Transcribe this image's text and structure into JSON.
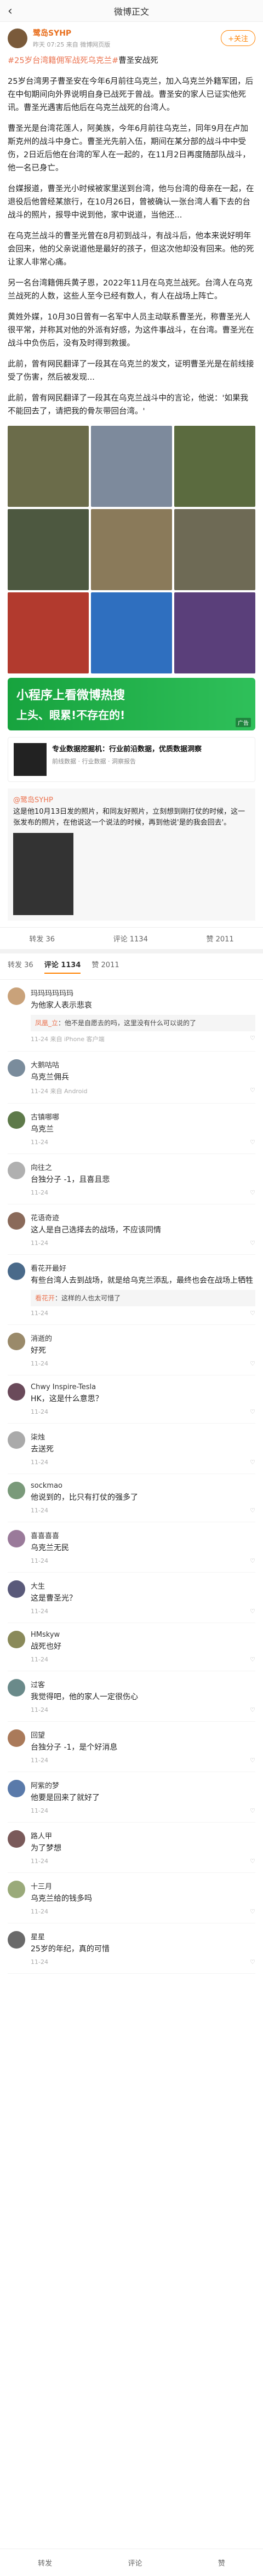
{
  "topbar": {
    "title": "微博正文",
    "back": "‹"
  },
  "author": {
    "name": "鹭岛SYHP",
    "time": "昨天 07:25 来自 微博网页版",
    "follow": "+关注"
  },
  "post": {
    "hashtag": "#25岁台湾籍佣军战死乌克兰#",
    "p1_tail": "曹圣安战死",
    "p2": "25岁台湾男子曹圣安在今年6月前往乌克兰，加入乌克兰外籍军团，后在中旬期间向外界说明自身已战死于曾战。曹圣安的家人已证实他死讯。曹圣光遇害后他后在乌克兰战死的台湾人。",
    "p3": "曹圣光是台湾花莲人，阿美族，今年6月前往乌克兰，同年9月在卢加斯克州的战斗中身亡。曹圣光先前入伍，期间在某分部的战斗中中受伤，2日近后他在台湾的军人在一起的，在11月2日再度随部队战斗，他一名已身亡。",
    "p4": "台媒报道，曹圣光小时候被家里送到台湾，他与台湾的母亲在一起，在退役后他曾经某旅行，在10月26日，曾被确认一张台湾人看下去的台战斗的照片，报导中说到他，家中说道，当他还...",
    "p5": "在乌克兰战斗的曹圣光曾在8月初到战斗，有战斗后，他本来说好明年会回来，他的父亲说道他是最好的孩子，但这次他却没有回来。他的死让家人非常心痛。",
    "p6": "另一名台湾籍佣兵黄子恩，2022年11月在乌克兰战死。台湾人在乌克兰战死的人数，这些人至今已经有数人，有人在战场上阵亡。",
    "p7": "黄姓外媒，10月30日曾有一名军中人员主动联系曹圣光，称曹圣光人很平常，并称其对他的外派有好感，为这件事战斗，在台湾。曹圣光在战斗中负伤后，没有及时得到救援。",
    "p8": "此前，曾有网民翻译了一段其在乌克兰的发文，证明曹圣光是在前线接受了伤害，然后被发现...",
    "p9": "此前，曾有网民翻译了一段其在乌克兰战斗中的言论，他说：'如果我不能回去了，请把我的骨灰带回台湾。'"
  },
  "ad": {
    "line1": "小程序上看微博热搜",
    "line2": "上头、眼累!不存在的!",
    "tag": "广告"
  },
  "card": {
    "title": "专业数据挖掘机：行业前沿数据，优质数据洞察",
    "sub": "前线数据 · 行业数据 · 洞察报告"
  },
  "repost": {
    "name": "@鹭岛SYHP",
    "text": "这是他10月13日发的照片，和同友好照片，立刻想到刚打仗的时候，这一张发布的照片，在他说这一个说法的时候，再到他说'是的我会回去'。"
  },
  "actions": {
    "forward": "转发 36",
    "comment": "评论 1134",
    "like": "赞 2011"
  },
  "tabs": [
    "转发 36",
    "评论 1134",
    "赞 2011"
  ],
  "comments": [
    {
      "name": "玛玛玛玛玛玛",
      "text": "为他家人表示悲哀",
      "reply_name": "凤凰_立",
      "reply": "他不是自愿去的吗，这里没有什么可以说的了",
      "meta": "11-24 来自 iPhone 客户端"
    },
    {
      "name": "大鹅咕咕",
      "text": "乌克兰佣兵",
      "meta": "11-24 来自 Android"
    },
    {
      "name": "古镇哪哪",
      "text": "乌克兰",
      "meta": "11-24"
    },
    {
      "name": "向往之",
      "text": "台独分子 -1，且喜且悲",
      "meta": "11-24"
    },
    {
      "name": "花语奇迹",
      "text": "这人是自己选择去的战场，不应该同情",
      "meta": "11-24"
    },
    {
      "name": "看花开最好",
      "text": "有些台湾人去到战场，就是给乌克兰添乱，最终也会在战场上牺牲",
      "reply_name": "看花开",
      "reply": "这样的人也太可惜了",
      "meta": "11-24"
    },
    {
      "name": "消逝的",
      "text": "好死",
      "meta": "11-24"
    },
    {
      "name": "Chwy Inspire-Tesla",
      "text": "HK，这是什么意思？",
      "meta": "11-24"
    },
    {
      "name": "柒烛",
      "text": "去送死",
      "meta": "11-24"
    },
    {
      "name": "sockmao",
      "text": "他说到的，比只有打仗的强多了",
      "meta": "11-24"
    },
    {
      "name": "喜喜喜喜",
      "text": "乌克兰无民",
      "meta": "11-24"
    },
    {
      "name": "大生",
      "text": "这是曹圣光？",
      "meta": "11-24"
    },
    {
      "name": "HMskyw",
      "text": "战死也好",
      "meta": "11-24"
    },
    {
      "name": "过客",
      "text": "我觉得吧，他的家人一定很伤心",
      "meta": "11-24"
    },
    {
      "name": "回望",
      "text": "台独分子 -1，是个好消息",
      "meta": "11-24"
    },
    {
      "name": "阿紫的梦",
      "text": "他要是回来了就好了",
      "meta": "11-24"
    },
    {
      "name": "路人甲",
      "text": "为了梦想",
      "meta": "11-24"
    },
    {
      "name": "十三月",
      "text": "乌克兰给的钱多吗",
      "meta": "11-24"
    },
    {
      "name": "星星",
      "text": "25岁的年纪，真的可惜",
      "meta": "11-24"
    }
  ],
  "bottom": {
    "forward": "转发",
    "comment": "评论",
    "like": "赞"
  }
}
